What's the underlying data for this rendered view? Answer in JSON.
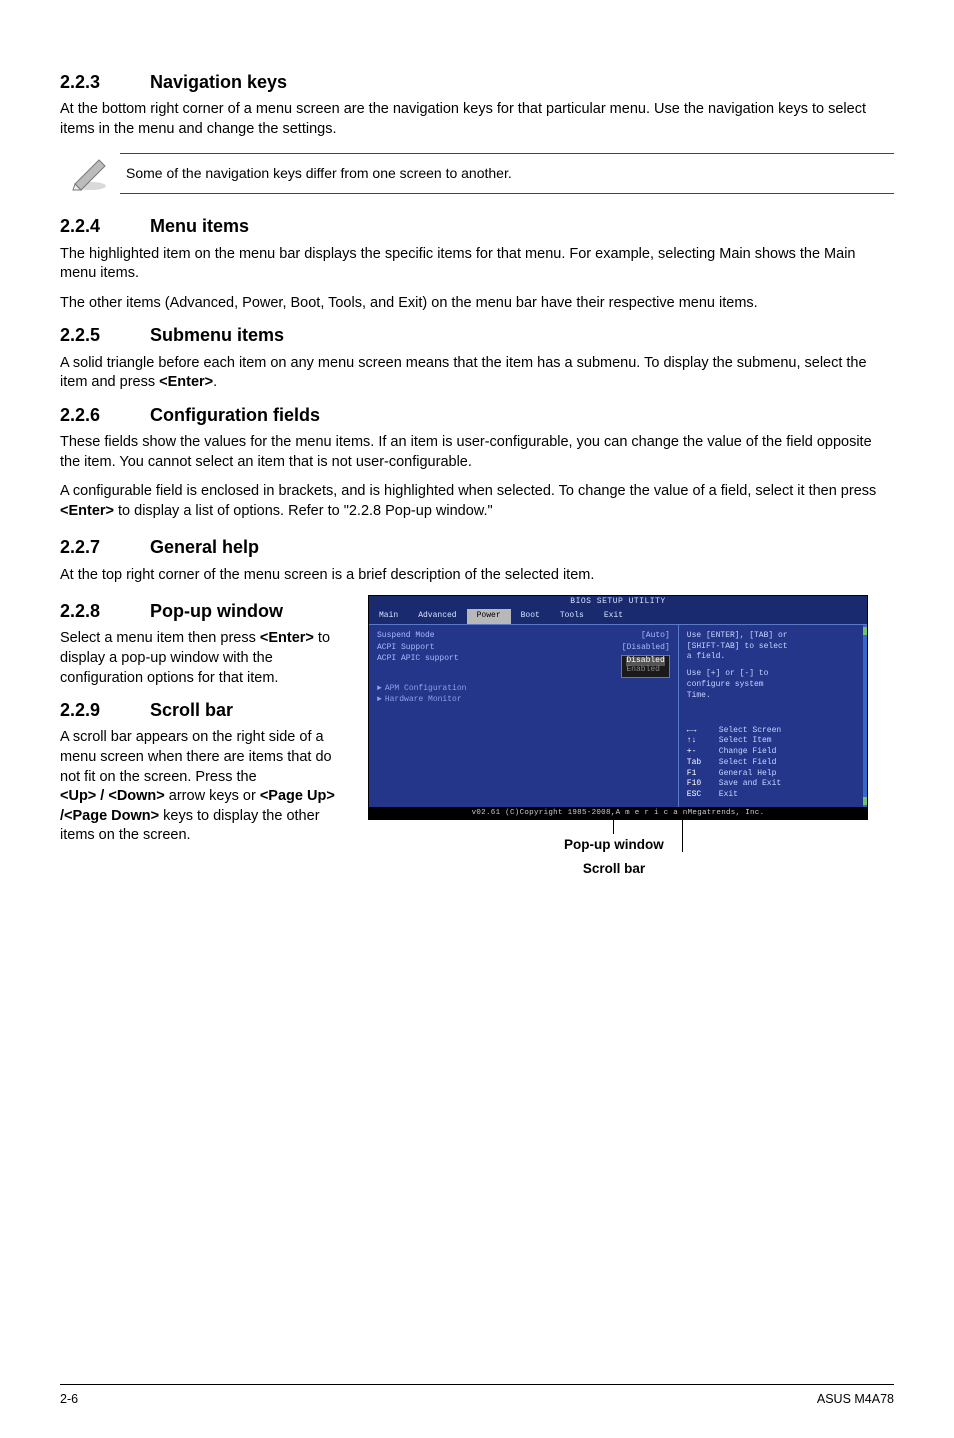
{
  "s223": {
    "num": "2.2.3",
    "title": "Navigation keys",
    "p1": "At the bottom right corner of a menu screen are the navigation keys for that particular menu. Use the navigation keys to select items in the menu and change the settings.",
    "note": "Some of the navigation keys differ from one screen to another."
  },
  "s224": {
    "num": "2.2.4",
    "title": "Menu items",
    "p1": "The highlighted item on the menu bar  displays the specific items for that menu. For example, selecting Main shows the Main menu items.",
    "p2": "The other items (Advanced, Power, Boot, Tools, and Exit) on the menu bar have their respective menu items."
  },
  "s225": {
    "num": "2.2.5",
    "title": "Submenu items",
    "p1a": "A solid triangle before each item on any menu screen means that the item has a submenu. To display the submenu, select the item and press ",
    "p1b": "<Enter>",
    "p1c": "."
  },
  "s226": {
    "num": "2.2.6",
    "title": "Configuration fields",
    "p1": "These fields show the values for the menu items. If an item is user-configurable, you can change the value of the field opposite the item. You cannot select an item that is not user-configurable.",
    "p2a": "A configurable field is enclosed in brackets, and is highlighted when selected. To change the value of a field, select it then press ",
    "p2b": "<Enter>",
    "p2c": " to display a list of options. Refer to \"2.2.8 Pop-up window.\""
  },
  "s227": {
    "num": "2.2.7",
    "title": "General help",
    "p1": "At the top right corner of the menu screen is a brief description of the selected item."
  },
  "s228": {
    "num": "2.2.8",
    "title": "Pop-up window",
    "p1a": "Select a menu item then press ",
    "p1b": "<Enter>",
    "p1c": " to display a pop-up window with the configuration options for that item."
  },
  "s229": {
    "num": "2.2.9",
    "title": "Scroll bar",
    "p1": "A scroll bar appears on the right side of a menu screen when there are items that do not fit on the screen. Press the",
    "p2a": "<Up> / <Down>",
    "p2b": " arrow keys or ",
    "p2c": "<Page Up> /<Page Down>",
    "p2d": " keys to display the other items on the screen."
  },
  "bios": {
    "title": "BIOS SETUP UTILITY",
    "tabs": {
      "main": "Main",
      "advanced": "Advanced",
      "power": "Power",
      "boot": "Boot",
      "tools": "Tools",
      "exit": "Exit"
    },
    "rows": {
      "r1l": "Suspend Mode",
      "r1v": "[Auto]",
      "r2l": "ACPI Support",
      "r2v": "[Disabled]",
      "r3l": "ACPI APIC support",
      "popup1": "Disabled",
      "popup2": "Enabled",
      "sub1": "APM Configuration",
      "sub2": "Hardware Monitor"
    },
    "help": {
      "l1": "Use [ENTER], [TAB] or",
      "l2": "[SHIFT-TAB] to select",
      "l3": "a field.",
      "l4": "Use [+] or [-] to",
      "l5": "configure system",
      "l6": "Time.",
      "k1l": "←→",
      "k1r": "Select Screen",
      "k2l": "↑↓",
      "k2r": "Select Item",
      "k3l": "+-",
      "k3r": "Change Field",
      "k4l": "Tab",
      "k4r": "Select Field",
      "k5l": "F1",
      "k5r": "General Help",
      "k6l": "F10",
      "k6r": "Save and Exit",
      "k7l": "ESC",
      "k7r": "Exit"
    },
    "foot": "v02.61 (C)Copyright 1985-2008,A m e r i c a nMegatrends, Inc."
  },
  "callouts": {
    "popup": "Pop-up window",
    "scroll": "Scroll bar"
  },
  "footer": {
    "left": "2-6",
    "right": "ASUS M4A78"
  }
}
